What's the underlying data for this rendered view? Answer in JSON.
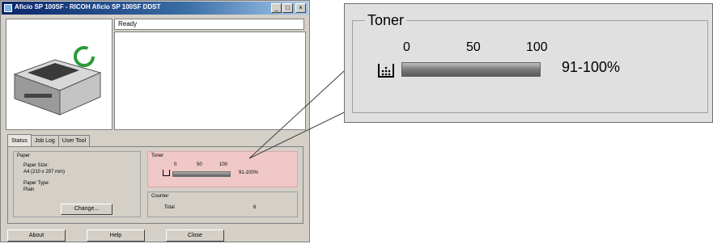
{
  "window": {
    "title": "Aficio SP 100SF - RICOH Aficio SP 100SF DDST",
    "status_text": "Ready",
    "tabs": [
      {
        "label": "Status",
        "active": true
      },
      {
        "label": "Job Log",
        "active": false
      },
      {
        "label": "User Tool",
        "active": false
      }
    ],
    "paper": {
      "group_label": "Paper",
      "size_label": "Paper Size:",
      "size_value": "A4 (210 x 297 mm)",
      "type_label": "Paper Type:",
      "type_value": "Plain",
      "change_button": "Change..."
    },
    "toner": {
      "group_label": "Toner",
      "ticks": [
        "0",
        "50",
        "100"
      ],
      "level_text": "91-100%",
      "level_fraction": 1.0
    },
    "counter": {
      "group_label": "Counter",
      "total_label": "Total",
      "total_value": "6"
    },
    "buttons": {
      "about": "About",
      "help": "Help",
      "close": "Close"
    }
  },
  "callout": {
    "title": "Toner",
    "ticks": [
      "0",
      "50",
      "100"
    ],
    "level_text": "91-100%",
    "level_fraction": 1.0,
    "icon": "toner-cartridge-icon"
  },
  "colors": {
    "titlebar": "#0a246a",
    "toner_highlight": "#f0c8c8",
    "ready_ring": "#2a9a3a"
  }
}
